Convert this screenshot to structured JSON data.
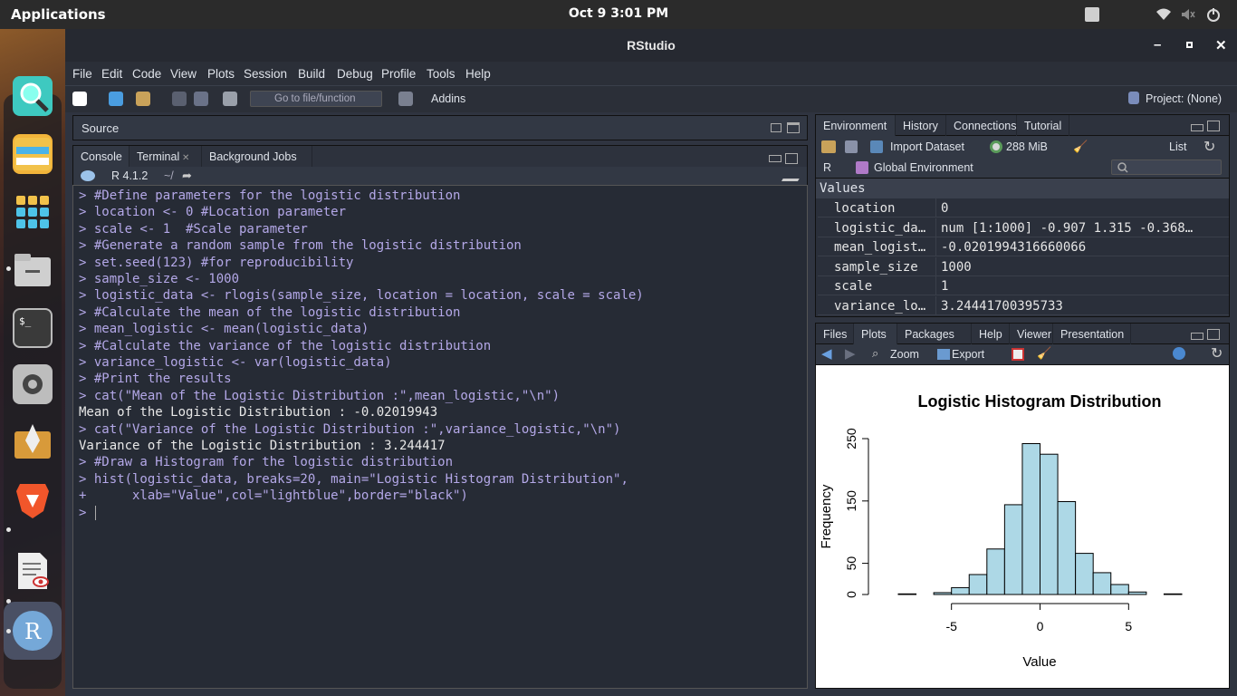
{
  "topbar": {
    "applications": "Applications",
    "datetime": "Oct 9   3:01 PM"
  },
  "window": {
    "title": "RStudio"
  },
  "menu": [
    "File",
    "Edit",
    "Code",
    "View",
    "Plots",
    "Session",
    "Build",
    "Debug",
    "Profile",
    "Tools",
    "Help"
  ],
  "toolbar": {
    "goto_placeholder": "Go to file/function",
    "addins": "Addins",
    "project": "Project: (None)"
  },
  "source": {
    "label": "Source"
  },
  "console_tabs": [
    "Console",
    "Terminal",
    "Background Jobs"
  ],
  "console_path": {
    "version": "R 4.1.2",
    "dir": "~/"
  },
  "console_lines": [
    {
      "t": "cmd",
      "s": "> #Define parameters for the logistic distribution"
    },
    {
      "t": "cmd",
      "s": "> location <- 0 #Location parameter"
    },
    {
      "t": "cmd",
      "s": "> scale <- 1  #Scale parameter"
    },
    {
      "t": "cmd",
      "s": "> #Generate a random sample from the logistic distribution"
    },
    {
      "t": "cmd",
      "s": "> set.seed(123) #for reproducibility"
    },
    {
      "t": "cmd",
      "s": "> sample_size <- 1000"
    },
    {
      "t": "cmd",
      "s": "> logistic_data <- rlogis(sample_size, location = location, scale = scale)"
    },
    {
      "t": "cmd",
      "s": "> #Calculate the mean of the logistic distribution"
    },
    {
      "t": "cmd",
      "s": "> mean_logistic <- mean(logistic_data)"
    },
    {
      "t": "cmd",
      "s": "> #Calculate the variance of the logistic distribution"
    },
    {
      "t": "cmd",
      "s": "> variance_logistic <- var(logistic_data)"
    },
    {
      "t": "cmd",
      "s": "> #Print the results"
    },
    {
      "t": "cmd",
      "s": "> cat(\"Mean of the Logistic Distribution :\",mean_logistic,\"\\n\")"
    },
    {
      "t": "out",
      "s": "Mean of the Logistic Distribution : -0.02019943"
    },
    {
      "t": "cmd",
      "s": "> cat(\"Variance of the Logistic Distribution :\",variance_logistic,\"\\n\")"
    },
    {
      "t": "out",
      "s": "Variance of the Logistic Distribution : 3.244417"
    },
    {
      "t": "cmd",
      "s": "> #Draw a Histogram for the logistic distribution"
    },
    {
      "t": "cmd",
      "s": "> hist(logistic_data, breaks=20, main=\"Logistic Histogram Distribution\","
    },
    {
      "t": "cmd",
      "s": "+      xlab=\"Value\",col=\"lightblue\",border=\"black\")"
    },
    {
      "t": "cmd",
      "s": "> "
    }
  ],
  "env_tabs": [
    "Environment",
    "History",
    "Connections",
    "Tutorial"
  ],
  "env_toolbar": {
    "import": "Import Dataset",
    "mem": "288 MiB",
    "list": "List",
    "lang": "R",
    "scope": "Global Environment"
  },
  "env_section": "Values",
  "env_values": [
    {
      "k": "location",
      "v": "0"
    },
    {
      "k": "logistic_da…",
      "v": "num [1:1000] -0.907 1.315 -0.368…"
    },
    {
      "k": "mean_logist…",
      "v": "-0.0201994316660066"
    },
    {
      "k": "sample_size",
      "v": "1000"
    },
    {
      "k": "scale",
      "v": "1"
    },
    {
      "k": "variance_lo…",
      "v": "3.24441700395733"
    }
  ],
  "files_tabs": [
    "Files",
    "Plots",
    "Packages",
    "Help",
    "Viewer",
    "Presentation"
  ],
  "plot_toolbar": {
    "zoom": "Zoom",
    "export": "Export"
  },
  "chart_data": {
    "type": "bar",
    "title": "Logistic Histogram Distribution",
    "xlabel": "Value",
    "ylabel": "Frequency",
    "bin_edges": [
      -8,
      -7,
      -6,
      -5,
      -4,
      -3,
      -2,
      -1,
      0,
      1,
      2,
      3,
      4,
      5,
      6,
      7,
      8
    ],
    "values": [
      1,
      0,
      3,
      11,
      32,
      73,
      144,
      242,
      225,
      149,
      66,
      35,
      16,
      4,
      0,
      1
    ],
    "xticks": [
      -5,
      0,
      5
    ],
    "yticks": [
      0,
      50,
      150,
      250
    ],
    "ylim": [
      0,
      250
    ],
    "xlim": [
      -8,
      8
    ],
    "bar_color": "#add8e6"
  }
}
